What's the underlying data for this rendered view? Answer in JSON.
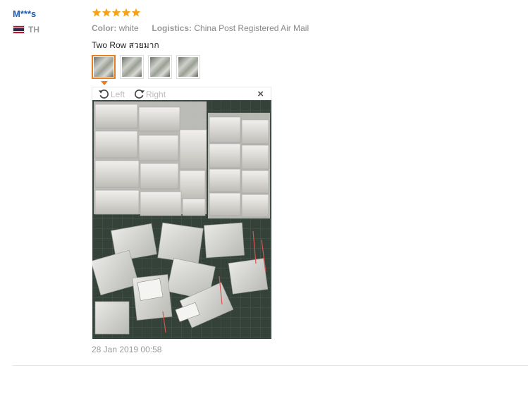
{
  "review": {
    "user_name": "M***s",
    "country_code": "TH",
    "rating": 5,
    "color_label": "Color:",
    "color_value": "white",
    "logistics_label": "Logistics:",
    "logistics_value": "China Post Registered Air Mail",
    "text": "Two Row สวยมาก",
    "thumbnail_count": 4,
    "selected_thumbnail": 0,
    "date": "28 Jan 2019 00:58"
  },
  "viewer": {
    "rotate_left_label": "Left",
    "rotate_right_label": "Right",
    "close_glyph": "×"
  },
  "colors": {
    "user_link": "#1a5fb4",
    "star": "#f7a21b",
    "accent": "#e67e22",
    "muted_text": "#999999"
  },
  "icons": [
    "star-icon",
    "thailand-flag-icon",
    "rotate-left-icon",
    "rotate-right-icon",
    "close-icon"
  ]
}
